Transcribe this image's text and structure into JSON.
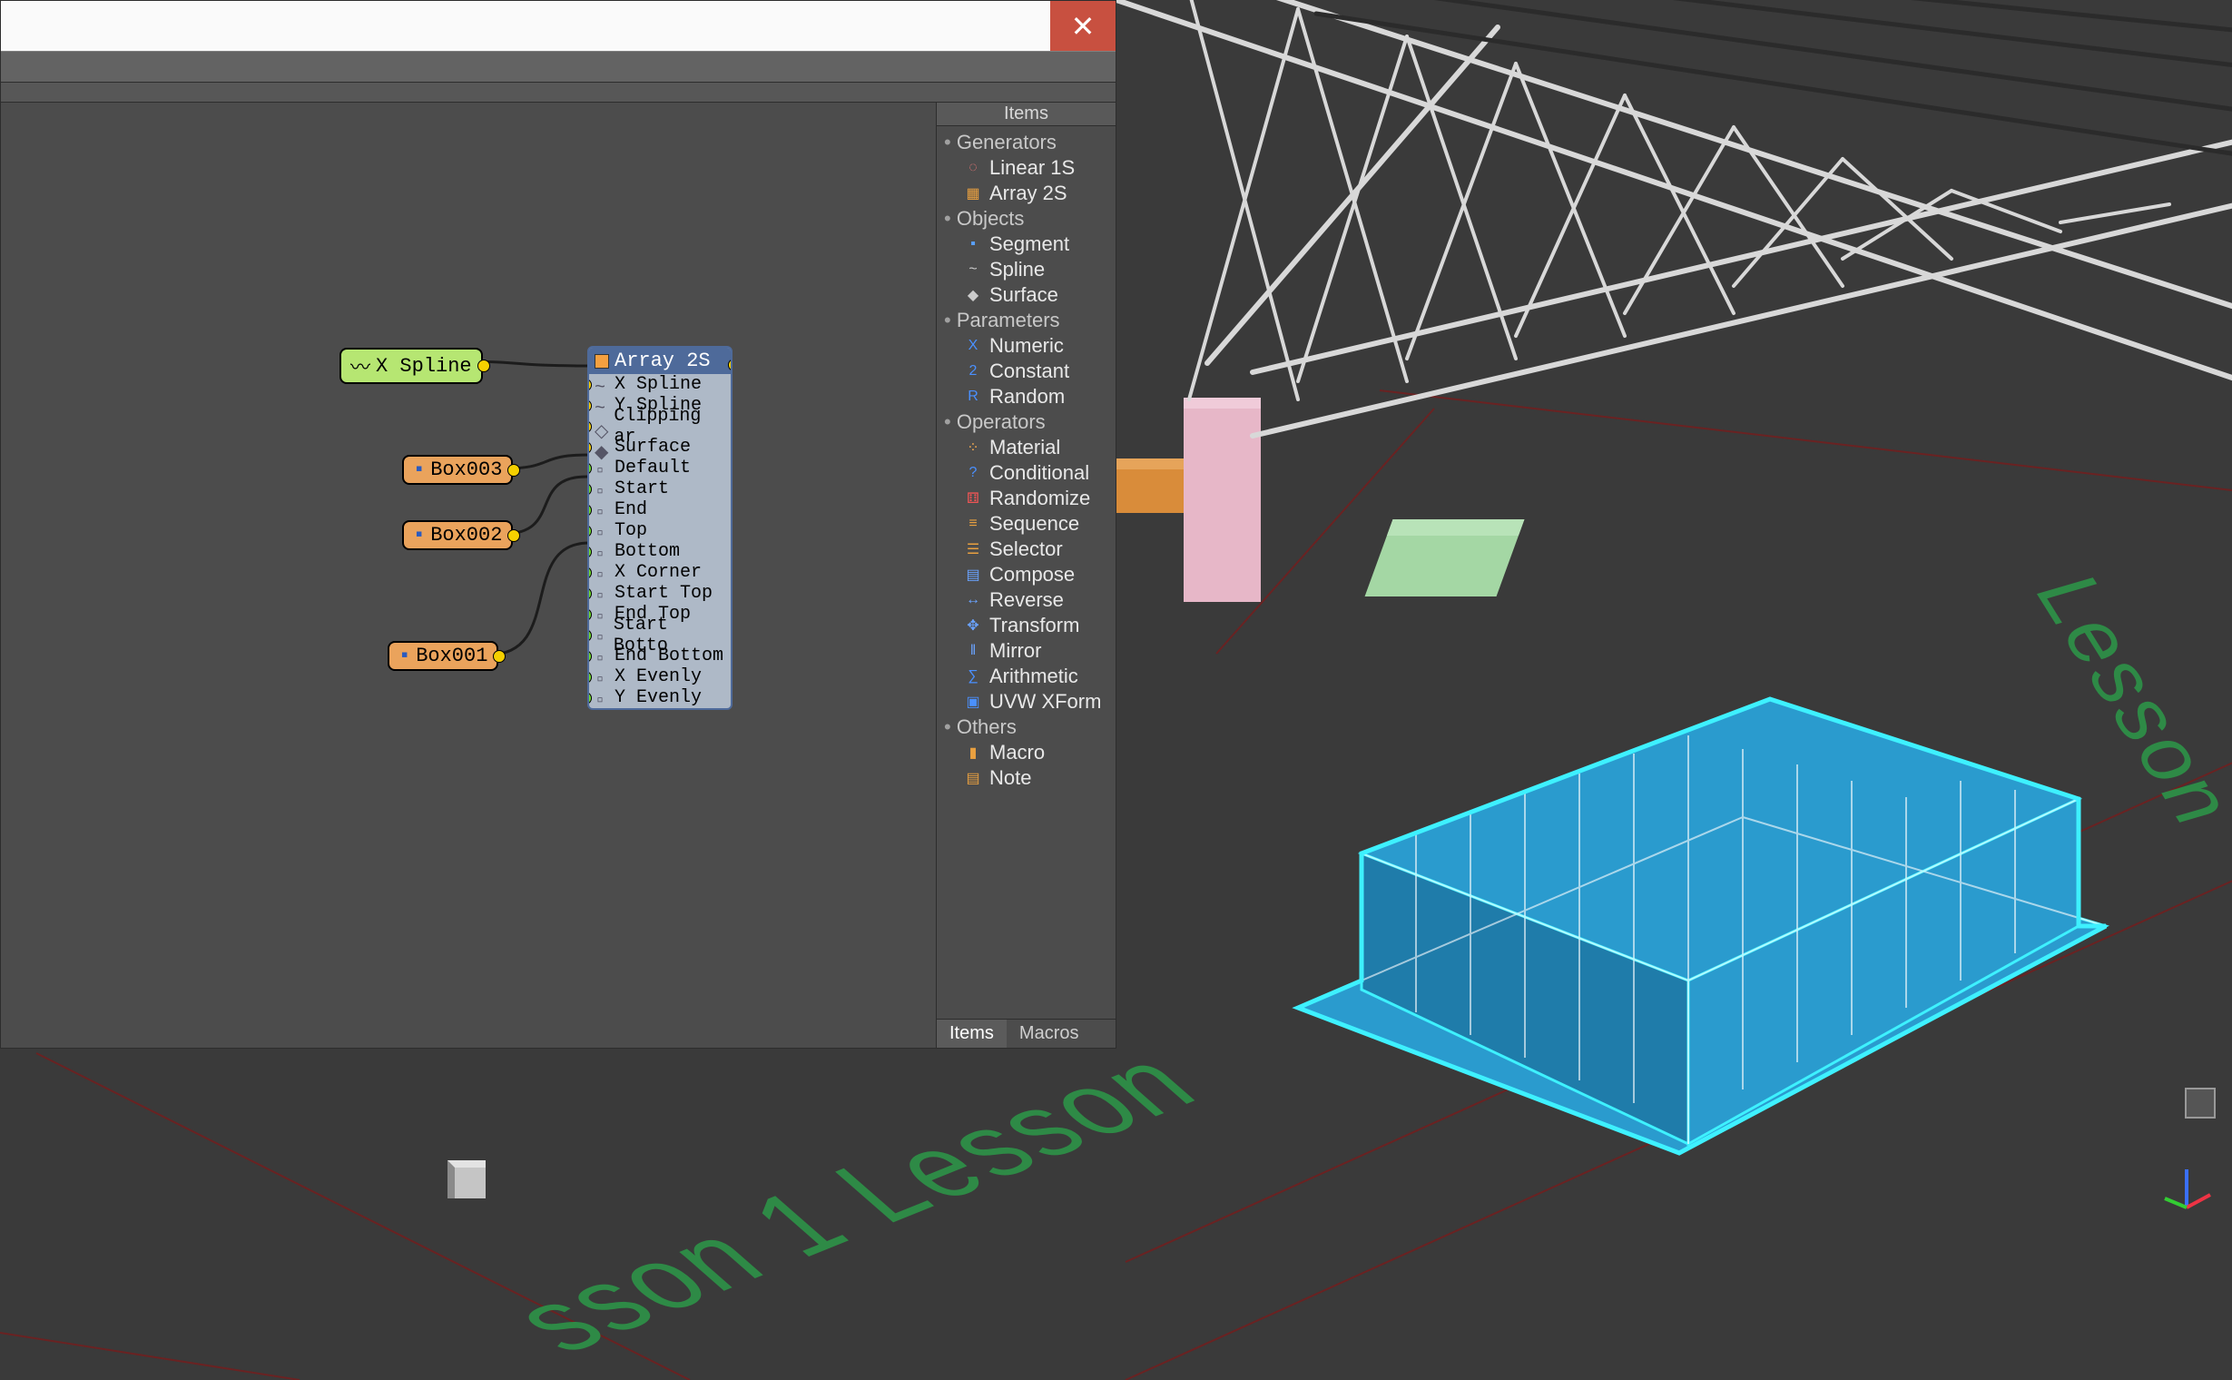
{
  "window": {
    "close_glyph": "✕"
  },
  "nodes": {
    "xspline": {
      "label": "X Spline"
    },
    "box003": {
      "label": "Box003"
    },
    "box002": {
      "label": "Box002"
    },
    "box001": {
      "label": "Box001"
    }
  },
  "array_node": {
    "title": "Array 2S",
    "rows": [
      {
        "label": "X Spline",
        "port": "y",
        "icon": "~"
      },
      {
        "label": "Y Spline",
        "port": "y",
        "icon": "~"
      },
      {
        "label": "Clipping ar",
        "port": "y",
        "icon": "◇"
      },
      {
        "label": "Surface",
        "port": "y",
        "icon": "◆"
      },
      {
        "label": "Default",
        "port": "g",
        "icon": "▫"
      },
      {
        "label": "Start",
        "port": "g",
        "icon": "▫"
      },
      {
        "label": "End",
        "port": "g",
        "icon": "▫"
      },
      {
        "label": "Top",
        "port": "g",
        "icon": "▫"
      },
      {
        "label": "Bottom",
        "port": "g",
        "icon": "▫"
      },
      {
        "label": "X Corner",
        "port": "g",
        "icon": "▫"
      },
      {
        "label": "Start Top",
        "port": "g",
        "icon": "▫"
      },
      {
        "label": "End Top",
        "port": "g",
        "icon": "▫"
      },
      {
        "label": "Start Botto",
        "port": "g",
        "icon": "▫"
      },
      {
        "label": "End Bottom",
        "port": "g",
        "icon": "▫"
      },
      {
        "label": "X Evenly",
        "port": "g",
        "icon": "▫"
      },
      {
        "label": "Y Evenly",
        "port": "g",
        "icon": "▫"
      }
    ]
  },
  "palette": {
    "header": "Items",
    "groups": [
      {
        "name": "Generators",
        "items": [
          {
            "label": "Linear 1S",
            "icon": "◌",
            "color": "#e77"
          },
          {
            "label": "Array 2S",
            "icon": "▦",
            "color": "#e9a040"
          }
        ]
      },
      {
        "name": "Objects",
        "items": [
          {
            "label": "Segment",
            "icon": "▪",
            "color": "#5aa0ff"
          },
          {
            "label": "Spline",
            "icon": "~",
            "color": "#ccc"
          },
          {
            "label": "Surface",
            "icon": "◆",
            "color": "#ccc"
          }
        ]
      },
      {
        "name": "Parameters",
        "items": [
          {
            "label": "Numeric",
            "icon": "X",
            "color": "#4a90ff"
          },
          {
            "label": "Constant",
            "icon": "2",
            "color": "#4a90ff"
          },
          {
            "label": "Random",
            "icon": "R",
            "color": "#4a90ff"
          }
        ]
      },
      {
        "name": "Operators",
        "items": [
          {
            "label": "Material",
            "icon": "⁘",
            "color": "#ffb050"
          },
          {
            "label": "Conditional",
            "icon": "?",
            "color": "#4a90ff"
          },
          {
            "label": "Randomize",
            "icon": "⚅",
            "color": "#e55"
          },
          {
            "label": "Sequence",
            "icon": "≡",
            "color": "#e9a040"
          },
          {
            "label": "Selector",
            "icon": "☰",
            "color": "#e9a040"
          },
          {
            "label": "Compose",
            "icon": "▤",
            "color": "#6aa3ff"
          },
          {
            "label": "Reverse",
            "icon": "↔",
            "color": "#6aa3ff"
          },
          {
            "label": "Transform",
            "icon": "✥",
            "color": "#6aa3ff"
          },
          {
            "label": "Mirror",
            "icon": "‖",
            "color": "#6aa3ff"
          },
          {
            "label": "Arithmetic",
            "icon": "∑",
            "color": "#4a90ff"
          },
          {
            "label": "UVW XForm",
            "icon": "▣",
            "color": "#4a90ff"
          }
        ]
      },
      {
        "name": "Others",
        "items": [
          {
            "label": "Macro",
            "icon": "▮",
            "color": "#e9a040"
          },
          {
            "label": "Note",
            "icon": "▤",
            "color": "#e9a040"
          }
        ]
      }
    ],
    "tabs": {
      "items": "Items",
      "macros": "Macros"
    }
  },
  "ground": {
    "text1": "Lesson",
    "text2": "sson 1 Lesson"
  }
}
